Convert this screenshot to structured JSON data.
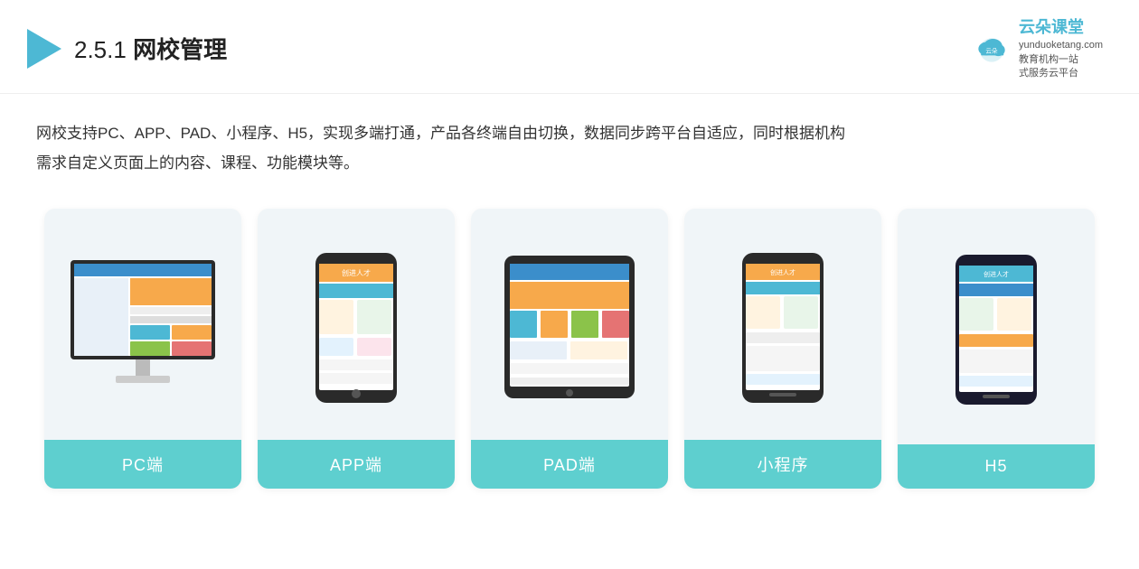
{
  "header": {
    "title_prefix": "2.5.1 ",
    "title_main": "网校管理",
    "logo_name": "云朵课堂",
    "logo_site": "yunduoketang.com",
    "logo_tagline1": "教育机构一站",
    "logo_tagline2": "式服务云平台"
  },
  "description": {
    "text1": "网校支持PC、APP、PAD、小程序、H5，实现多端打通，产品各终端自由切换，数据同步跨平台自适应，同时根据机构",
    "text2": "需求自定义页面上的内容、课程、功能模块等。"
  },
  "cards": [
    {
      "id": "pc",
      "label": "PC端"
    },
    {
      "id": "app",
      "label": "APP端"
    },
    {
      "id": "pad",
      "label": "PAD端"
    },
    {
      "id": "miniprogram",
      "label": "小程序"
    },
    {
      "id": "h5",
      "label": "H5"
    }
  ]
}
